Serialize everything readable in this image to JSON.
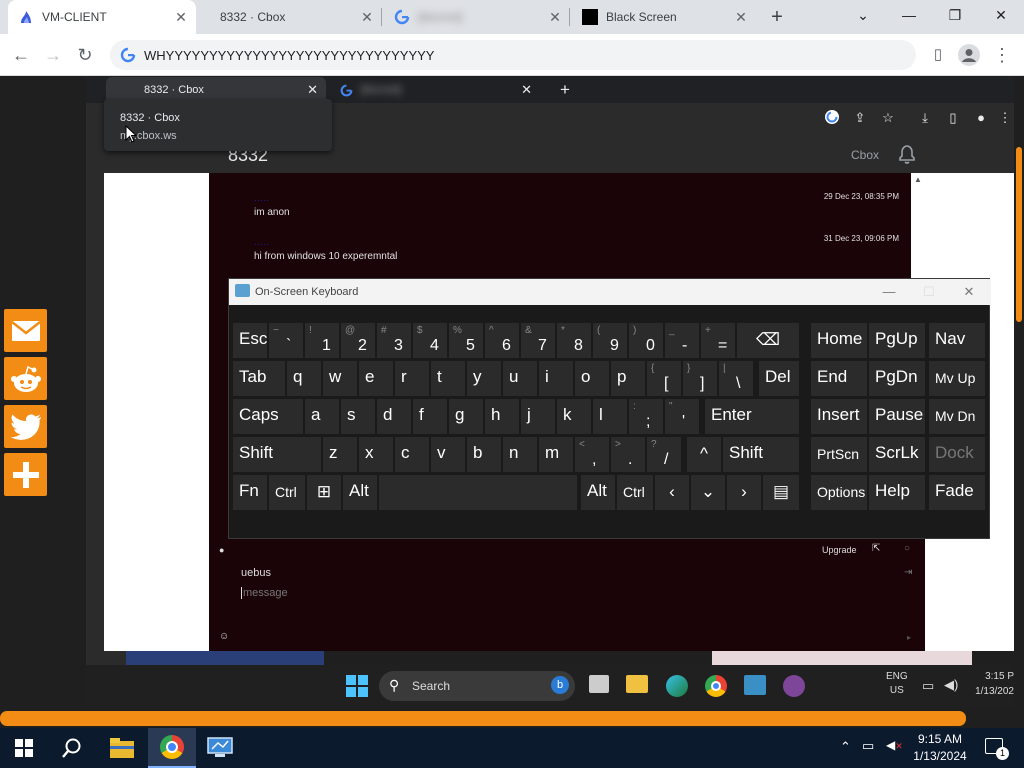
{
  "outer_browser": {
    "tabs": [
      {
        "title": "VM-CLIENT",
        "active": true
      },
      {
        "title": "8332 · Cbox",
        "active": false
      },
      {
        "title": "[blurred]",
        "active": false
      },
      {
        "title": "Black Screen",
        "active": false
      }
    ],
    "address": "WHYYYYYYYYYYYYYYYYYYYYYYYYYYYYYYY"
  },
  "share_buttons": [
    "mail-icon",
    "reddit-icon",
    "twitter-icon",
    "plus-icon"
  ],
  "inner_browser": {
    "tabs": [
      {
        "title": "8332 · Cbox"
      },
      {
        "title": "[blurred]"
      }
    ],
    "hover_card": {
      "title": "8332 · Cbox",
      "domain": "my.cbox.ws"
    },
    "page_title": "8332",
    "brand": "Cbox"
  },
  "chat": {
    "messages": [
      {
        "text": "im anon",
        "time": "29 Dec 23, 08:35 PM"
      },
      {
        "text": "hi from windows 10 experemntal",
        "time": "31 Dec 23, 09:06 PM"
      }
    ],
    "upgrade": "Upgrade",
    "username": "uebus",
    "placeholder": "message"
  },
  "osk": {
    "title": "On-Screen Keyboard"
  },
  "vm_taskbar": {
    "search": "Search",
    "lang": "ENG",
    "region": "US",
    "time": "3:15 P",
    "date": "1/13/202"
  },
  "host_taskbar": {
    "time": "9:15 AM",
    "date": "1/13/2024",
    "notif_count": "1"
  },
  "colors": {
    "accent_orange": "#f28c14",
    "chat_bg": "#1b0408"
  }
}
